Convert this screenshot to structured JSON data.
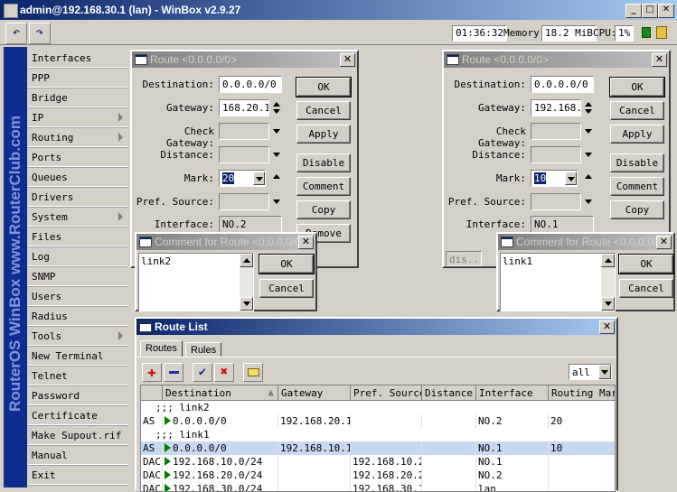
{
  "app": {
    "title": "admin@192.168.30.1 (lan) - WinBox v2.9.27",
    "time": "01:36:32",
    "memory_label": "Memory:",
    "memory_value": "18.2 MiB",
    "cpu_label": "CPU:",
    "cpu_value": "1%",
    "brand": "RouterOS WinBox   www.RouterClub.com"
  },
  "menu": [
    {
      "label": "Interfaces",
      "submenu": false
    },
    {
      "label": "PPP",
      "submenu": false
    },
    {
      "label": "Bridge",
      "submenu": false
    },
    {
      "label": "IP",
      "submenu": true
    },
    {
      "label": "Routing",
      "submenu": true
    },
    {
      "label": "Ports",
      "submenu": false
    },
    {
      "label": "Queues",
      "submenu": false
    },
    {
      "label": "Drivers",
      "submenu": false
    },
    {
      "label": "System",
      "submenu": true
    },
    {
      "label": "Files",
      "submenu": false
    },
    {
      "label": "Log",
      "submenu": false
    },
    {
      "label": "SNMP",
      "submenu": false
    },
    {
      "label": "Users",
      "submenu": false
    },
    {
      "label": "Radius",
      "submenu": false
    },
    {
      "label": "Tools",
      "submenu": true
    },
    {
      "label": "New Terminal",
      "submenu": false
    },
    {
      "label": "Telnet",
      "submenu": false
    },
    {
      "label": "Password",
      "submenu": false
    },
    {
      "label": "Certificate",
      "submenu": false
    },
    {
      "label": "Make Supout.rif",
      "submenu": false
    },
    {
      "label": "Manual",
      "submenu": false
    },
    {
      "label": "Exit",
      "submenu": false
    }
  ],
  "route_labels": {
    "destination": "Destination:",
    "gateway": "Gateway:",
    "check_gateway": "Check Gateway:",
    "distance": "Distance:",
    "mark": "Mark:",
    "pref_source": "Pref. Source:",
    "interface": "Interface:"
  },
  "route_buttons": {
    "ok": "OK",
    "cancel": "Cancel",
    "apply": "Apply",
    "disable": "Disable",
    "comment": "Comment",
    "copy": "Copy",
    "remove": "Remove"
  },
  "route1": {
    "title": "Route <0.0.0.0/0>",
    "destination": "0.0.0.0/0",
    "gateway": "168.20.1",
    "mark": "20",
    "interface": "NO.2"
  },
  "route2": {
    "title": "Route <0.0.0.0/0>",
    "destination": "0.0.0.0/0",
    "gateway": "192.168.",
    "mark": "10",
    "interface": "NO.1",
    "status": "dis..."
  },
  "comment1": {
    "title": "Comment for Route <0.0.0.0/0>",
    "text": "link2",
    "ok": "OK",
    "cancel": "Cancel"
  },
  "comment2": {
    "title": "Comment for Route <0.0.0.0/0>",
    "text": "link1",
    "ok": "OK",
    "cancel": "Cancel"
  },
  "route_list": {
    "title": "Route List",
    "tabs": [
      "Routes",
      "Rules"
    ],
    "filter": "all",
    "columns": [
      "Destination",
      "Gateway",
      "Pref. Source",
      "Distance",
      "Interface",
      "Routing Mark"
    ],
    "rows": [
      {
        "comment": ";;; link2"
      },
      {
        "flags": "AS",
        "destination": "0.0.0.0/0",
        "gateway": "192.168.20.1",
        "pref_source": "",
        "distance": "",
        "interface": "NO.2",
        "mark": "20"
      },
      {
        "comment": ";;; link1"
      },
      {
        "flags": "AS",
        "destination": "0.0.0.0/0",
        "gateway": "192.168.10.1",
        "pref_source": "",
        "distance": "",
        "interface": "NO.1",
        "mark": "10",
        "selected": true
      },
      {
        "flags": "DAC",
        "destination": "192.168.10.0/24",
        "gateway": "",
        "pref_source": "192.168.10.2",
        "distance": "",
        "interface": "NO.1",
        "mark": ""
      },
      {
        "flags": "DAC",
        "destination": "192.168.20.0/24",
        "gateway": "",
        "pref_source": "192.168.20.2",
        "distance": "",
        "interface": "NO.2",
        "mark": ""
      },
      {
        "flags": "DAC",
        "destination": "192.168.30.0/24",
        "gateway": "",
        "pref_source": "192.168.30.1",
        "distance": "",
        "interface": "lan",
        "mark": ""
      }
    ]
  },
  "colors": {
    "titlebar": "#0a246a",
    "brand_strip": "#0f2c8f",
    "selection": "#0a246a"
  }
}
